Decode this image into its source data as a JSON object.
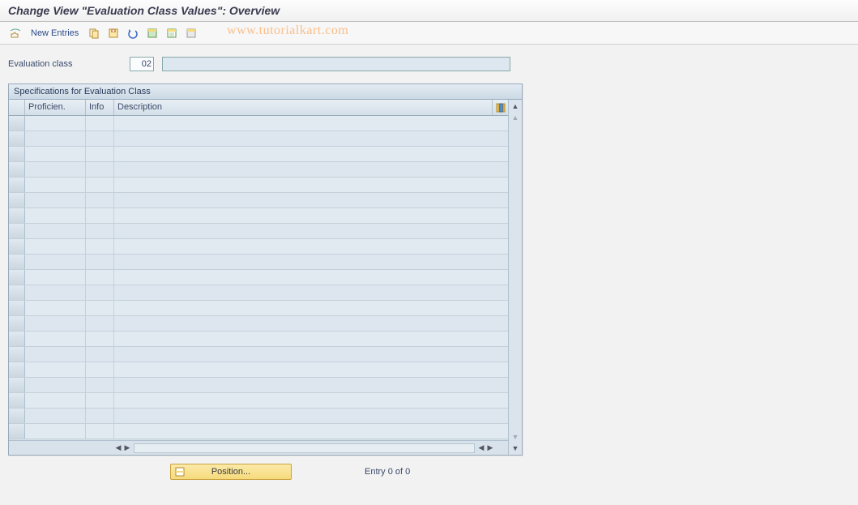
{
  "title": "Change View \"Evaluation Class Values\": Overview",
  "toolbar": {
    "new_entries": "New Entries"
  },
  "watermark": "www.tutorialkart.com",
  "field": {
    "label": "Evaluation class",
    "value": "02",
    "description": ""
  },
  "panel": {
    "title": "Specifications for Evaluation Class",
    "columns": {
      "proficiency": "Proficien.",
      "info": "Info",
      "description": "Description"
    }
  },
  "footer": {
    "position": "Position...",
    "entry": "Entry 0 of 0"
  },
  "icons": {
    "toggle": "toggle-icon",
    "copy": "copy-icon",
    "save": "save-icon",
    "undo": "undo-icon",
    "select_all": "select-all-icon",
    "select_block": "select-block-icon",
    "deselect": "deselect-icon",
    "config": "configure-icon"
  }
}
